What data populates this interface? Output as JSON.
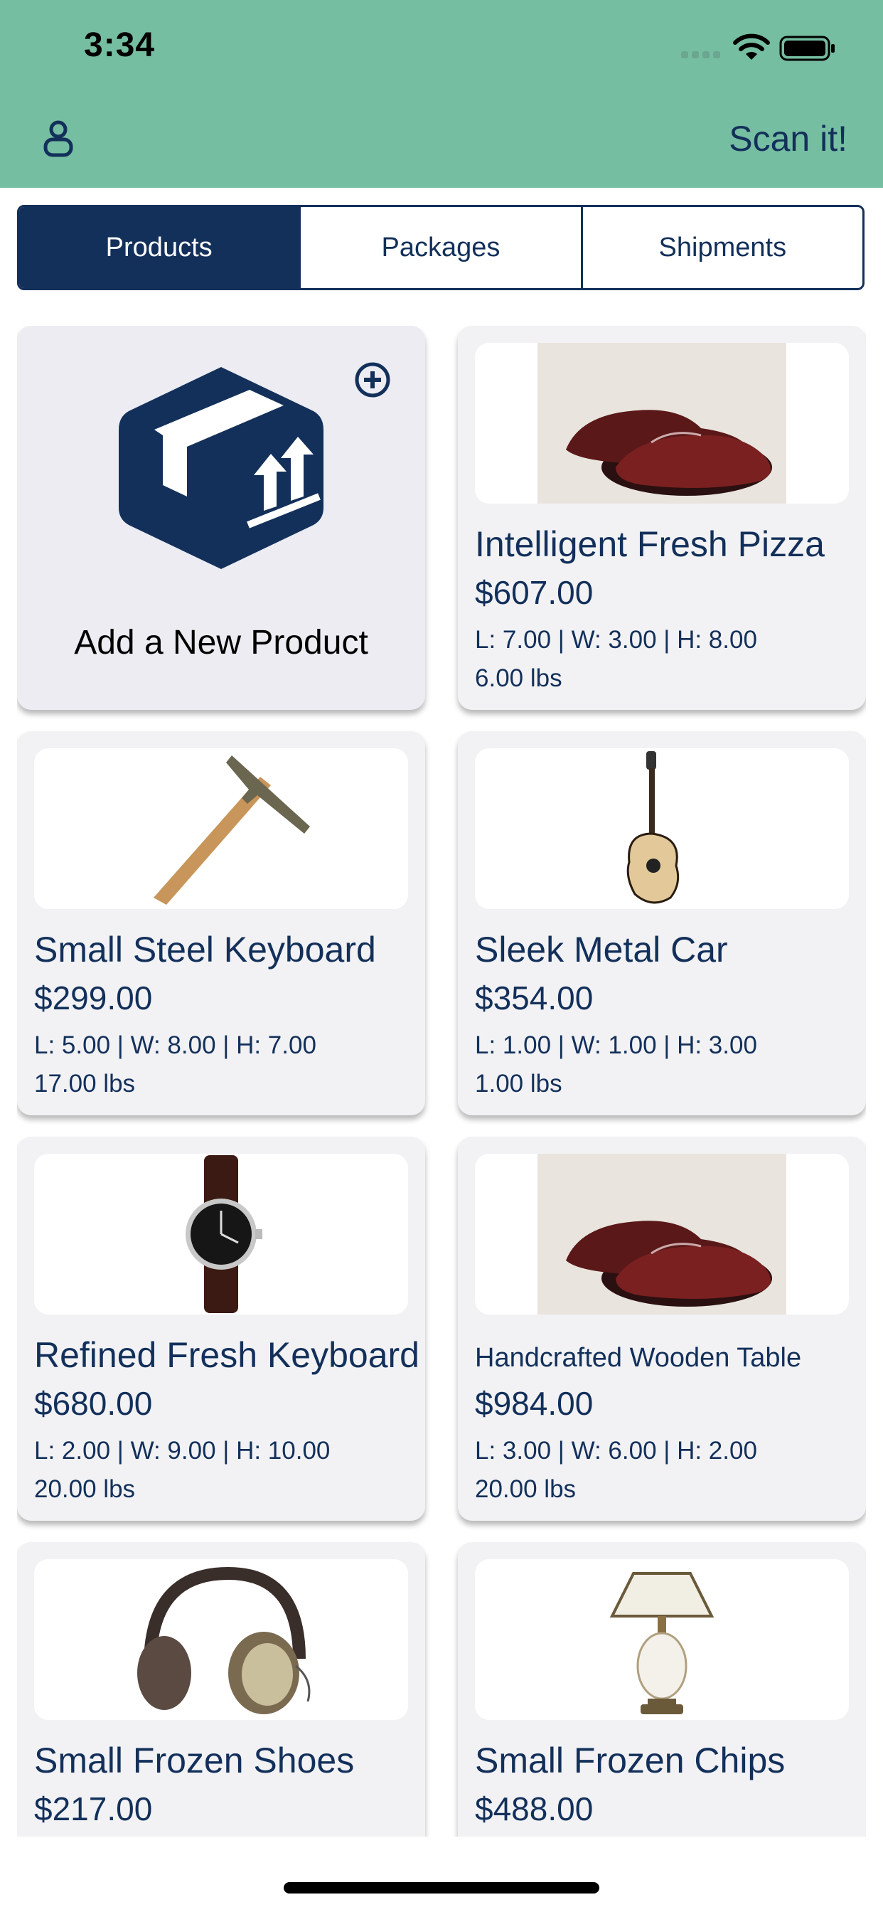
{
  "status_bar": {
    "time": "3:34"
  },
  "header": {
    "scan_label": "Scan it!"
  },
  "tabs": [
    {
      "label": "Products",
      "active": true
    },
    {
      "label": "Packages",
      "active": false
    },
    {
      "label": "Shipments",
      "active": false
    }
  ],
  "add_card": {
    "label": "Add a New Product"
  },
  "products": [
    {
      "name": "Intelligent Fresh Pizza",
      "price": "$607.00",
      "dims": "L: 7.00 | W: 3.00 | H: 8.00",
      "weight": "6.00 lbs",
      "image": "shoes"
    },
    {
      "name": "Small Steel Keyboard",
      "price": "$299.00",
      "dims": "L: 5.00 | W: 8.00 | H: 7.00",
      "weight": "17.00 lbs",
      "image": "hammer"
    },
    {
      "name": "Sleek Metal Car",
      "price": "$354.00",
      "dims": "L: 1.00 | W: 1.00 | H: 3.00",
      "weight": "1.00 lbs",
      "image": "guitar"
    },
    {
      "name": "Refined Fresh Keyboard",
      "price": "$680.00",
      "dims": "L: 2.00 | W: 9.00 | H: 10.00",
      "weight": "20.00 lbs",
      "image": "watch"
    },
    {
      "name": "Handcrafted Wooden Table",
      "price": "$984.00",
      "dims": "L: 3.00 | W: 6.00 | H: 2.00",
      "weight": "20.00 lbs",
      "image": "shoes"
    },
    {
      "name": "Small Frozen Shoes",
      "price": "$217.00",
      "dims": "",
      "weight": "",
      "image": "headphones"
    },
    {
      "name": "Small Frozen Chips",
      "price": "$488.00",
      "dims": "",
      "weight": "",
      "image": "lamp"
    }
  ],
  "colors": {
    "header_bg": "#76bea1",
    "primary": "#13305a",
    "card_bg": "#f2f2f5"
  }
}
